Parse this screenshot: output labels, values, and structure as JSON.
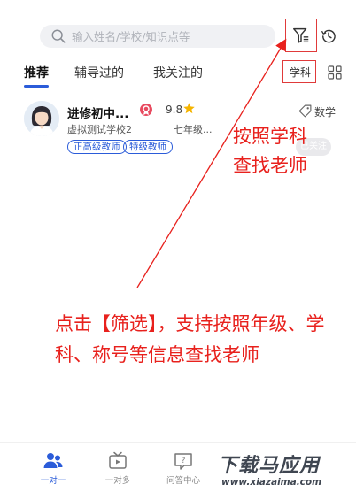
{
  "search": {
    "placeholder": "输入姓名/学校/知识点等"
  },
  "tabs": [
    {
      "label": "推荐",
      "active": true
    },
    {
      "label": "辅导过的",
      "active": false
    },
    {
      "label": "我关注的",
      "active": false
    }
  ],
  "subject_filter": {
    "label": "学科"
  },
  "teacher_card": {
    "name": "进修初中...",
    "score": "9.8",
    "subject": "数学",
    "school": "虚拟测试学校2",
    "grade": "七年级...",
    "tags": [
      "正高级教师",
      "特级教师"
    ],
    "action_label": "已关注"
  },
  "annotations": {
    "filter_hint": "按照学科\n查找老师",
    "main_hint": "点击【筛选】，支持按照年级、学科、称号等信息查找老师"
  },
  "bottom_nav": [
    {
      "label": "一对一",
      "icon": "people-icon",
      "active": true
    },
    {
      "label": "一对多",
      "icon": "tv-icon",
      "active": false
    },
    {
      "label": "问答中心",
      "icon": "qa-icon",
      "active": false
    }
  ],
  "watermark": {
    "title": "下载马应用",
    "url": "www.xiazaima.com"
  },
  "colors": {
    "accent": "#2b5cd9",
    "annotation": "#e8211d",
    "star": "#f5b400",
    "badge": "#e84a5f"
  }
}
